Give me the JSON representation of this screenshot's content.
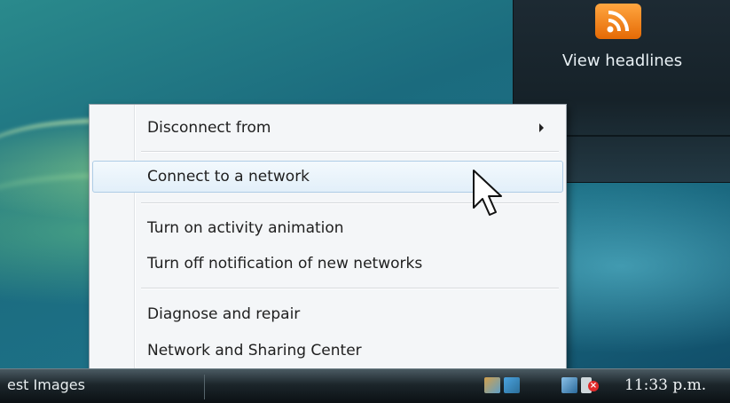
{
  "gadget": {
    "headline_label": "View headlines",
    "icon": "rss-feed-icon"
  },
  "context_menu": {
    "items": [
      {
        "label": "Disconnect from",
        "submenu": true
      },
      {
        "label": "Connect to a network",
        "hovered": true
      },
      {
        "label": "Turn on activity animation"
      },
      {
        "label": "Turn off notification of new networks"
      },
      {
        "label": "Diagnose and repair"
      },
      {
        "label": "Network and Sharing Center"
      }
    ]
  },
  "taskbar": {
    "window_label": "est Images",
    "clock": "11:33 p.m.",
    "tray_icons": [
      "network-icon",
      "network-connections-icon",
      "display-icon",
      "volume-muted-icon"
    ]
  },
  "colors": {
    "menu_background": "#f4f6f8",
    "hover_background": "#e2eff9",
    "rss_orange": "#f08a20"
  }
}
